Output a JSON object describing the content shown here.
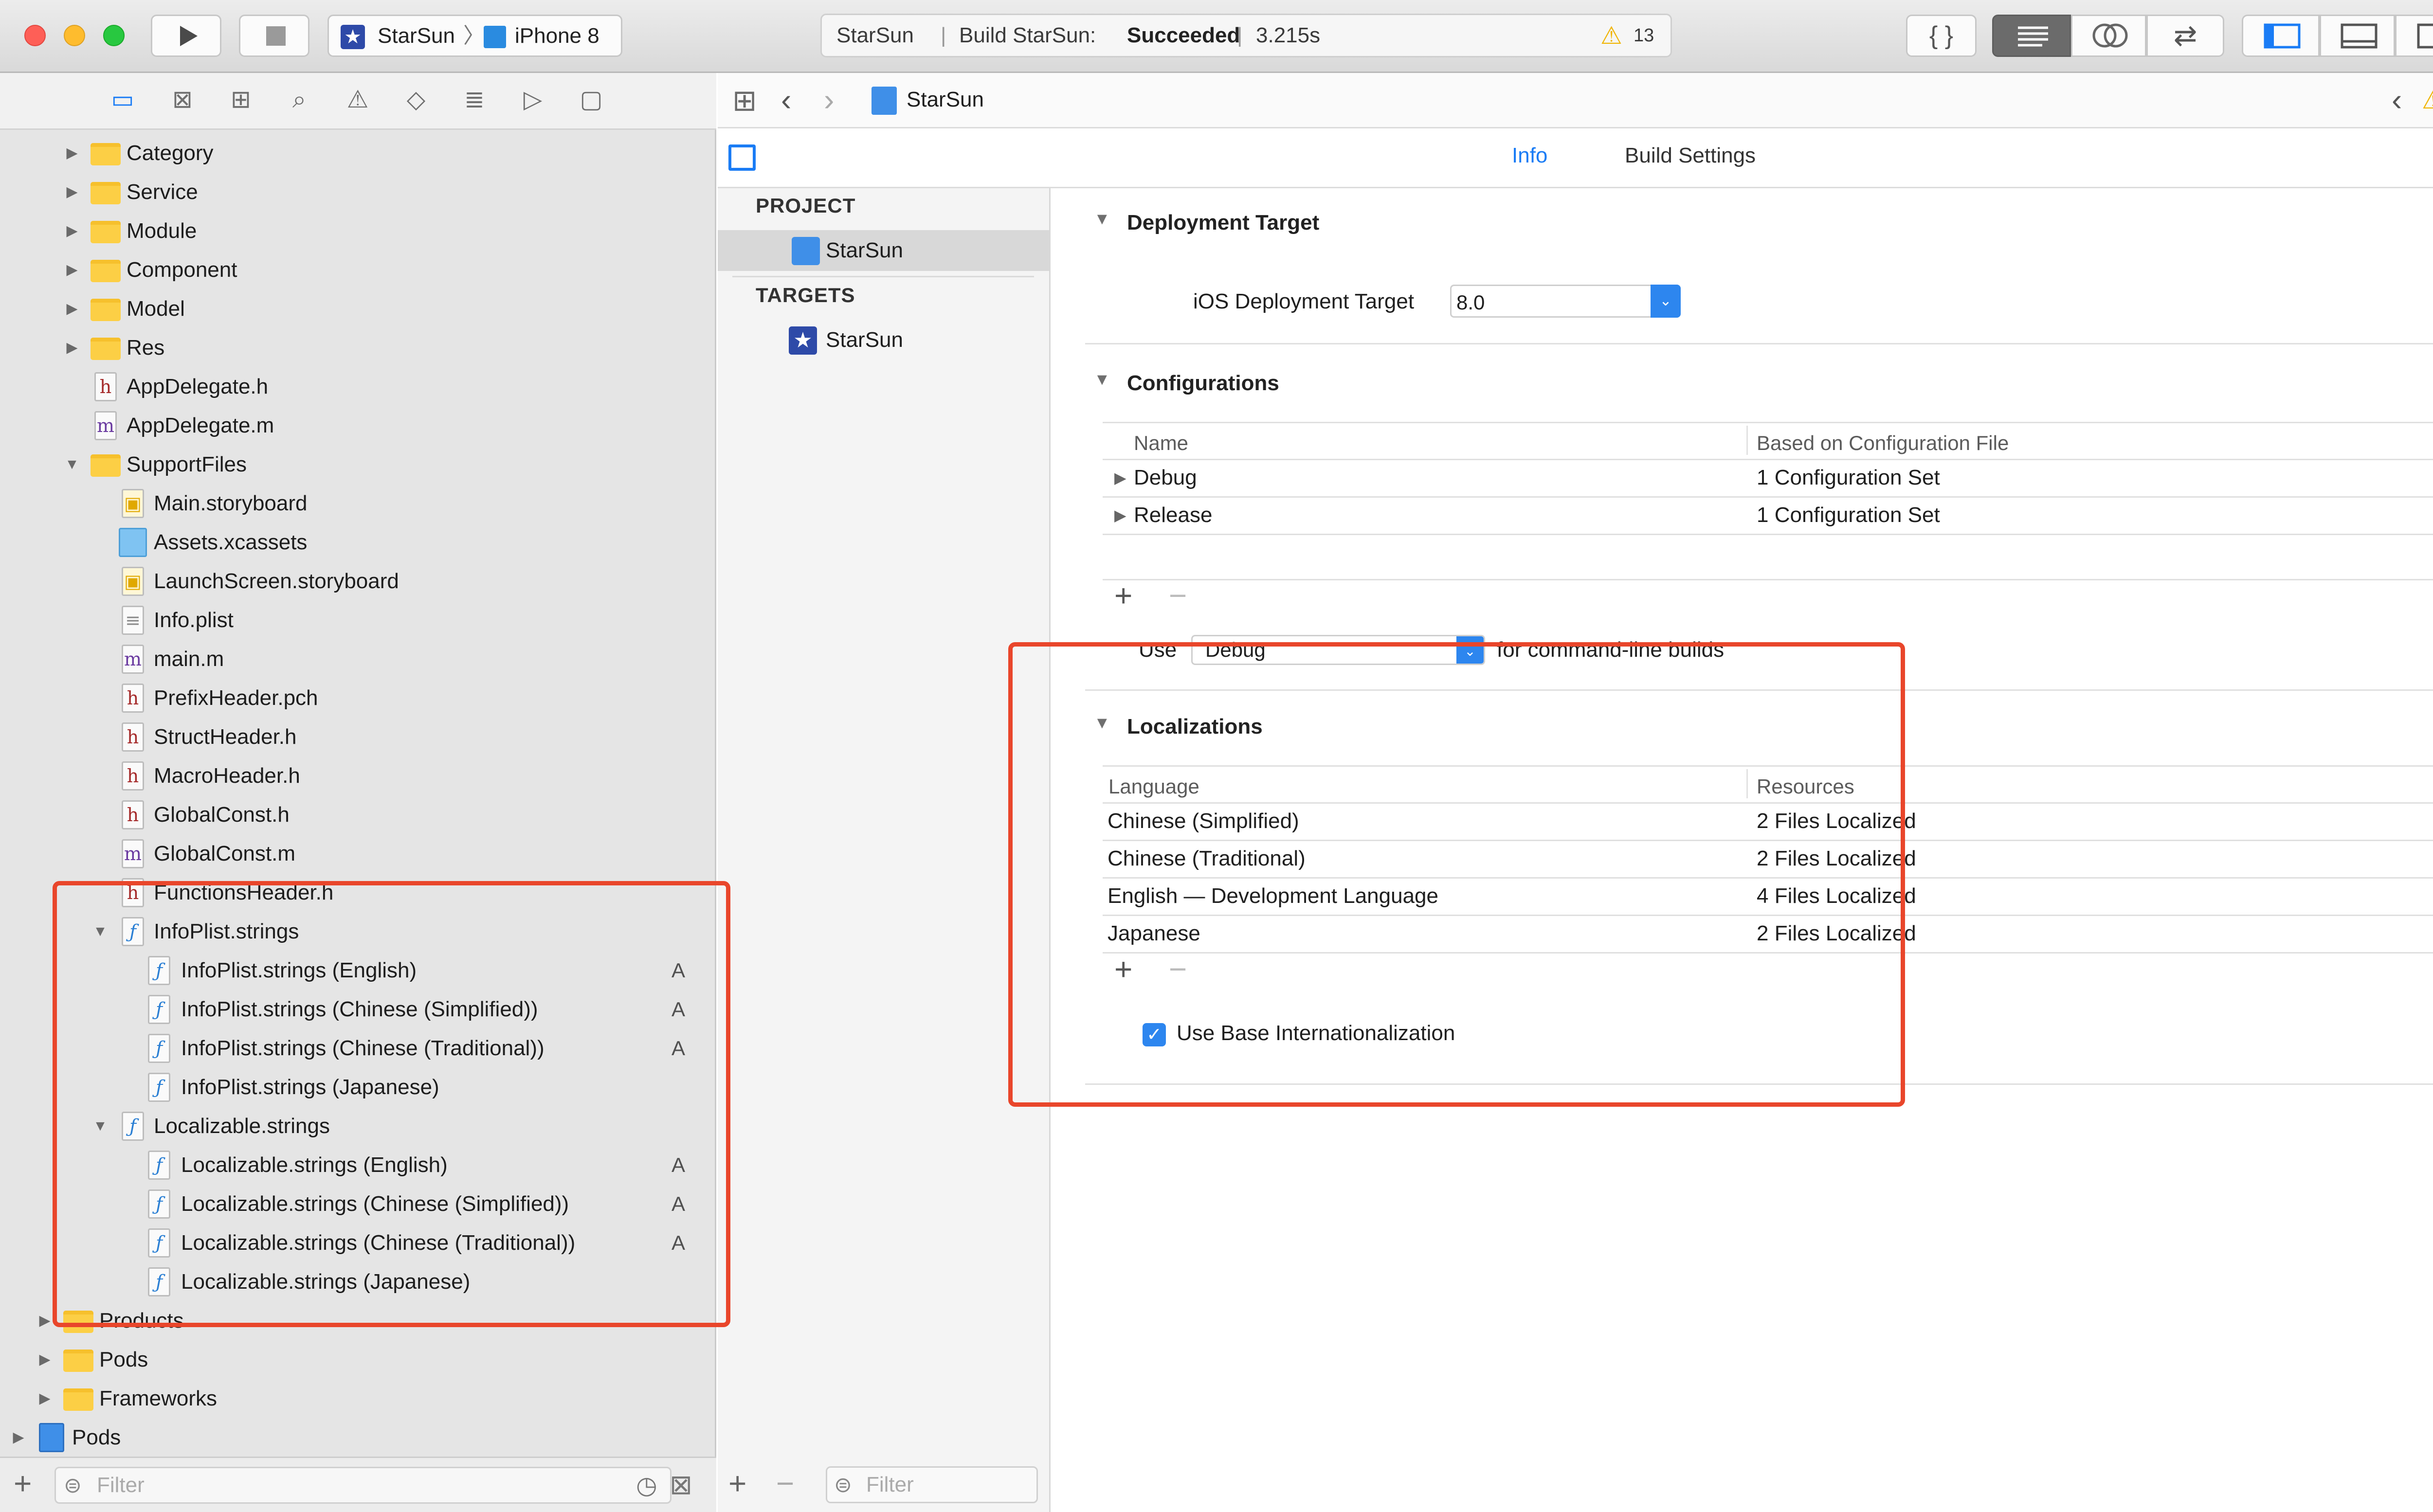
{
  "toolbar": {
    "scheme": "StarSun",
    "device": "iPhone 8",
    "activity_project": "StarSun",
    "activity_status_prefix": "Build StarSun:",
    "activity_status": "Succeeded",
    "activity_time": "3.215s",
    "warning_count": "13",
    "colors": {
      "close": "#fe5f57",
      "minimize": "#febc2e",
      "zoom": "#28c840"
    }
  },
  "navigator": {
    "items": [
      {
        "label": "Category"
      },
      {
        "label": "Service"
      },
      {
        "label": "Module"
      },
      {
        "label": "Component"
      },
      {
        "label": "Model"
      },
      {
        "label": "Res"
      },
      {
        "label": "AppDelegate.h",
        "icon": "h"
      },
      {
        "label": "AppDelegate.m",
        "icon": "m"
      },
      {
        "label": "SupportFiles"
      },
      {
        "label": "Main.storyboard"
      },
      {
        "label": "Assets.xcassets"
      },
      {
        "label": "LaunchScreen.storyboard"
      },
      {
        "label": "Info.plist"
      },
      {
        "label": "main.m",
        "icon": "m"
      },
      {
        "label": "PrefixHeader.pch",
        "icon": "h"
      },
      {
        "label": "StructHeader.h",
        "icon": "h"
      },
      {
        "label": "MacroHeader.h",
        "icon": "h"
      },
      {
        "label": "GlobalConst.h",
        "icon": "h"
      },
      {
        "label": "GlobalConst.m",
        "icon": "m"
      },
      {
        "label": "FunctionsHeader.h",
        "icon": "h"
      },
      {
        "label": "InfoPlist.strings"
      },
      {
        "label": "InfoPlist.strings (English)",
        "badge": "A"
      },
      {
        "label": "InfoPlist.strings (Chinese (Simplified))",
        "badge": "A"
      },
      {
        "label": "InfoPlist.strings (Chinese (Traditional))",
        "badge": "A"
      },
      {
        "label": "InfoPlist.strings (Japanese)"
      },
      {
        "label": "Localizable.strings"
      },
      {
        "label": "Localizable.strings (English)",
        "badge": "A"
      },
      {
        "label": "Localizable.strings (Chinese (Simplified))",
        "badge": "A"
      },
      {
        "label": "Localizable.strings (Chinese (Traditional))",
        "badge": "A"
      },
      {
        "label": "Localizable.strings (Japanese)"
      },
      {
        "label": "Products"
      },
      {
        "label": "Pods"
      },
      {
        "label": "Frameworks"
      },
      {
        "label": "Pods"
      }
    ],
    "filter_placeholder": "Filter",
    "icon_glyphs": {
      "h": "h",
      "m": "m",
      "strings": "ƒ"
    }
  },
  "editor": {
    "breadcrumb": "StarSun",
    "tabs": {
      "info": "Info",
      "build_settings": "Build Settings"
    }
  },
  "project_list": {
    "project_header": "PROJECT",
    "project_name": "StarSun",
    "targets_header": "TARGETS",
    "target_name": "StarSun",
    "filter_placeholder": "Filter"
  },
  "content": {
    "deployment": {
      "title": "Deployment Target",
      "label": "iOS Deployment Target",
      "value": "8.0"
    },
    "configurations": {
      "title": "Configurations",
      "headers": [
        "Name",
        "Based on Configuration File"
      ],
      "rows": [
        {
          "name": "Debug",
          "file": "1 Configuration Set"
        },
        {
          "name": "Release",
          "file": "1 Configuration Set"
        }
      ],
      "use_label": "Use",
      "use_value": "Debug",
      "use_suffix": "for command-line builds"
    },
    "localizations": {
      "title": "Localizations",
      "headers": [
        "Language",
        "Resources"
      ],
      "rows": [
        {
          "language": "Chinese (Simplified)",
          "resources": "2 Files Localized"
        },
        {
          "language": "Chinese (Traditional)",
          "resources": "2 Files Localized"
        },
        {
          "language": "English — Development Language",
          "resources": "4 Files Localized"
        },
        {
          "language": "Japanese",
          "resources": "2 Files Localized"
        }
      ],
      "base_intl_label": "Use Base Internationalization",
      "base_intl_checked": true
    }
  },
  "annotation_color": "#e9462b"
}
